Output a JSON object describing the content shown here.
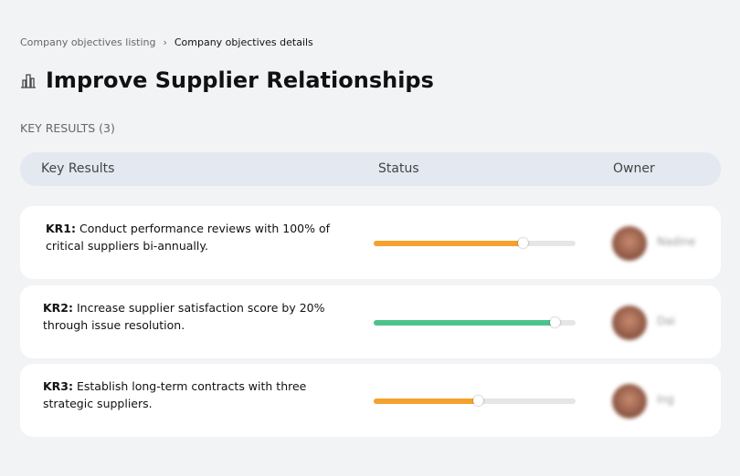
{
  "breadcrumb": {
    "parent": "Company objectives listing",
    "separator": "›",
    "current": "Company objectives details"
  },
  "title": "Improve Supplier Relationships",
  "title_icon": "building-chart-icon",
  "key_results_count": "KEY RESULTS (3)",
  "table": {
    "headers": [
      "Key Results",
      "Status",
      "Owner"
    ],
    "rows": [
      {
        "code": "KR1:",
        "text": "Conduct performance reviews with 100% of critical suppliers bi-annually.",
        "progress": 74,
        "color": "#f5a12f",
        "owner": "Nadine"
      },
      {
        "code": "KR2:",
        "text": "Increase supplier satisfaction score by 20% through issue resolution.",
        "progress": 90,
        "color": "#4cc38a",
        "owner": "Dai"
      },
      {
        "code": "KR3:",
        "text": "Establish long-term contracts with three strategic suppliers.",
        "progress": 52,
        "color": "#f5a12f",
        "owner": "Ing"
      }
    ]
  }
}
